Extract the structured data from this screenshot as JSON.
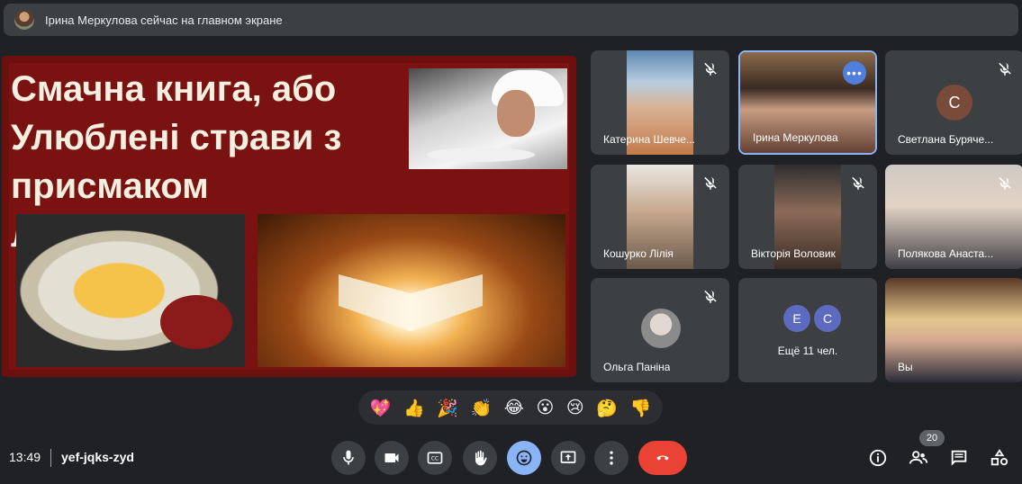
{
  "banner": {
    "text": "Ірина Меркулова сейчас на главном экране"
  },
  "slide": {
    "title": "Смачна книга, або Улюблені страви з присмаком літератури"
  },
  "tiles": [
    {
      "name": "Катерина Шевче..."
    },
    {
      "name": "Ірина Меркулова"
    },
    {
      "name": "Светлана Буряче...",
      "initial": "С"
    },
    {
      "name": "Кошурко Лілія"
    },
    {
      "name": "Вікторія Воловик"
    },
    {
      "name": "Полякова Анаста..."
    },
    {
      "name": "Ольга Паніна"
    },
    {
      "more_label": "Ещё 11 чел.",
      "initials": [
        "Е",
        "С"
      ]
    },
    {
      "name": "Вы"
    }
  ],
  "reactions": [
    "💖",
    "👍",
    "🎉",
    "👏",
    "😂",
    "😮",
    "😢",
    "🤔",
    "👎"
  ],
  "bottom": {
    "time": "13:49",
    "meeting_code": "yef-jqks-zyd",
    "participants_count": "20"
  },
  "colors": {
    "background": "#202124",
    "tile": "#3c4043",
    "accent": "#8ab4f8",
    "end_call": "#ea4335"
  },
  "icons": [
    "mic-icon",
    "camera-icon",
    "captions-icon",
    "raise-hand-icon",
    "emoji-icon",
    "present-icon",
    "more-icon",
    "end-call-icon",
    "info-icon",
    "people-icon",
    "chat-icon",
    "activities-icon"
  ]
}
